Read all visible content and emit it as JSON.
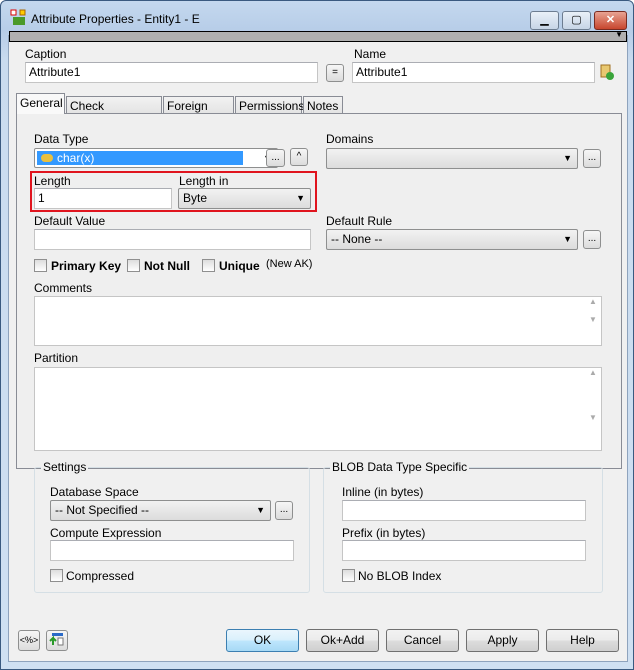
{
  "window": {
    "title": "Attribute Properties - Entity1 - E",
    "minimize": "▁",
    "maximize": "▢",
    "close": "✕"
  },
  "caption": {
    "label": "Caption",
    "value": "Attribute1"
  },
  "equal_button": "=",
  "name": {
    "label": "Name",
    "value": "Attribute1"
  },
  "tabs": [
    "General",
    "Check Constraints",
    "Foreign Keys",
    "Permissions",
    "Notes"
  ],
  "general": {
    "data_type": {
      "label": "Data Type",
      "value": "char(x)",
      "more": "...",
      "up": "^"
    },
    "domains": {
      "label": "Domains",
      "value": "",
      "more": "..."
    },
    "length": {
      "label": "Length",
      "value": "1"
    },
    "length_in": {
      "label": "Length in",
      "value": "Byte"
    },
    "default_value": {
      "label": "Default Value",
      "value": ""
    },
    "default_rule": {
      "label": "Default Rule",
      "value": "-- None --",
      "more": "..."
    },
    "primary_key": "Primary Key",
    "not_null": "Not Null",
    "unique": "Unique",
    "new_ak": "(New AK)",
    "comments": "Comments",
    "partition": "Partition",
    "settings": {
      "title": "Settings",
      "database_space": "Database Space",
      "database_space_value": "-- Not Specified --",
      "more": "...",
      "compute_expression": "Compute Expression",
      "compressed": "Compressed"
    },
    "blob": {
      "title": "BLOB Data Type Specific",
      "inline": "Inline (in bytes)",
      "prefix": "Prefix (in bytes)",
      "no_blob_index": "No BLOB Index"
    }
  },
  "footer": {
    "macro": "<%>",
    "ok": "OK",
    "ok_add": "Ok+Add",
    "cancel": "Cancel",
    "apply": "Apply",
    "help": "Help"
  },
  "highlight_color": "#e0141e"
}
